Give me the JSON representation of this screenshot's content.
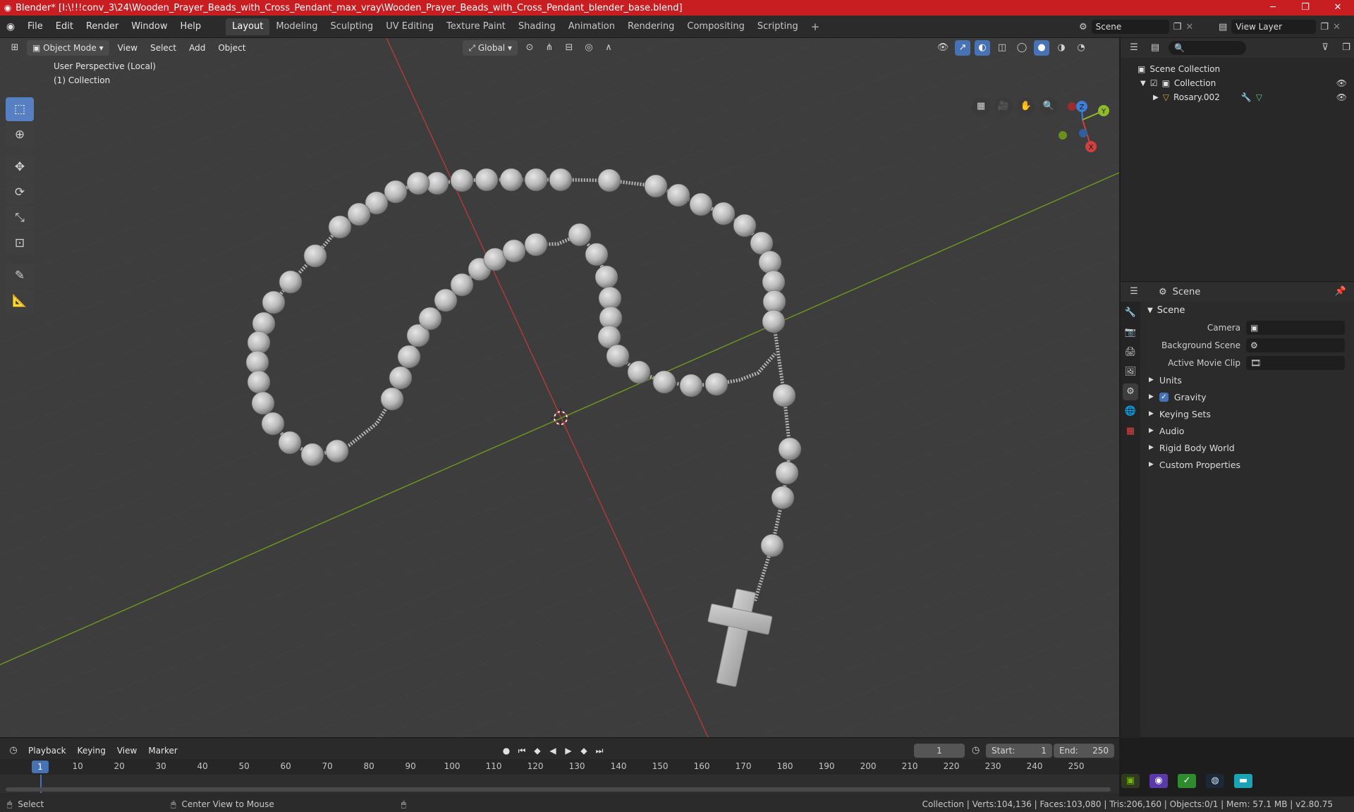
{
  "titlebar": {
    "title": "Blender* [I:\\!!!conv_3\\24\\Wooden_Prayer_Beads_with_Cross_Pendant_max_vray\\Wooden_Prayer_Beads_with_Cross_Pendant_blender_base.blend]",
    "minimize": "─",
    "maximize": "❐",
    "close": "✕"
  },
  "menu": {
    "items": [
      "File",
      "Edit",
      "Render",
      "Window",
      "Help"
    ],
    "tabs": [
      "Layout",
      "Modeling",
      "Sculpting",
      "UV Editing",
      "Texture Paint",
      "Shading",
      "Animation",
      "Rendering",
      "Compositing",
      "Scripting"
    ],
    "active_tab": "Layout",
    "add_tab": "+",
    "scene": "Scene",
    "view_layer": "View Layer"
  },
  "viewport": {
    "mode": "Object Mode",
    "menus": [
      "View",
      "Select",
      "Add",
      "Object"
    ],
    "orientation": "Global",
    "view_label": "User Perspective (Local)",
    "collection_label": "(1) Collection",
    "gizmo": {
      "x": "X",
      "y": "Y",
      "z": "Z"
    }
  },
  "timeline": {
    "menus": [
      "Playback",
      "Keying",
      "View",
      "Marker"
    ],
    "current_frame": "1",
    "start_label": "Start:",
    "start": "1",
    "end_label": "End:",
    "end": "250",
    "marker_frame": "1",
    "ticks": [
      "10",
      "20",
      "30",
      "40",
      "50",
      "60",
      "70",
      "80",
      "90",
      "100",
      "110",
      "120",
      "130",
      "140",
      "150",
      "160",
      "170",
      "180",
      "190",
      "200",
      "210",
      "220",
      "230",
      "240",
      "250"
    ]
  },
  "statusbar": {
    "select": "Select",
    "center": "Center View to Mouse",
    "stats": "Collection | Verts:104,136 | Faces:103,080 | Tris:206,160 | Objects:0/1 | Mem: 57.1 MB | v2.80.75"
  },
  "outliner": {
    "root": "Scene Collection",
    "collection": "Collection",
    "object": "Rosary.002"
  },
  "properties": {
    "header": "Scene",
    "panel": "Scene",
    "camera_label": "Camera",
    "background_scene_label": "Background Scene",
    "active_movie_clip_label": "Active Movie Clip",
    "subpanels": [
      "Units",
      "Gravity",
      "Keying Sets",
      "Audio",
      "Rigid Body World",
      "Custom Properties"
    ]
  },
  "colors": {
    "accent": "#4772b3",
    "titlebar": "#c81e22",
    "x_axis": "#d04040",
    "y_axis": "#8fba2a",
    "z_axis": "#3d7fd6"
  }
}
